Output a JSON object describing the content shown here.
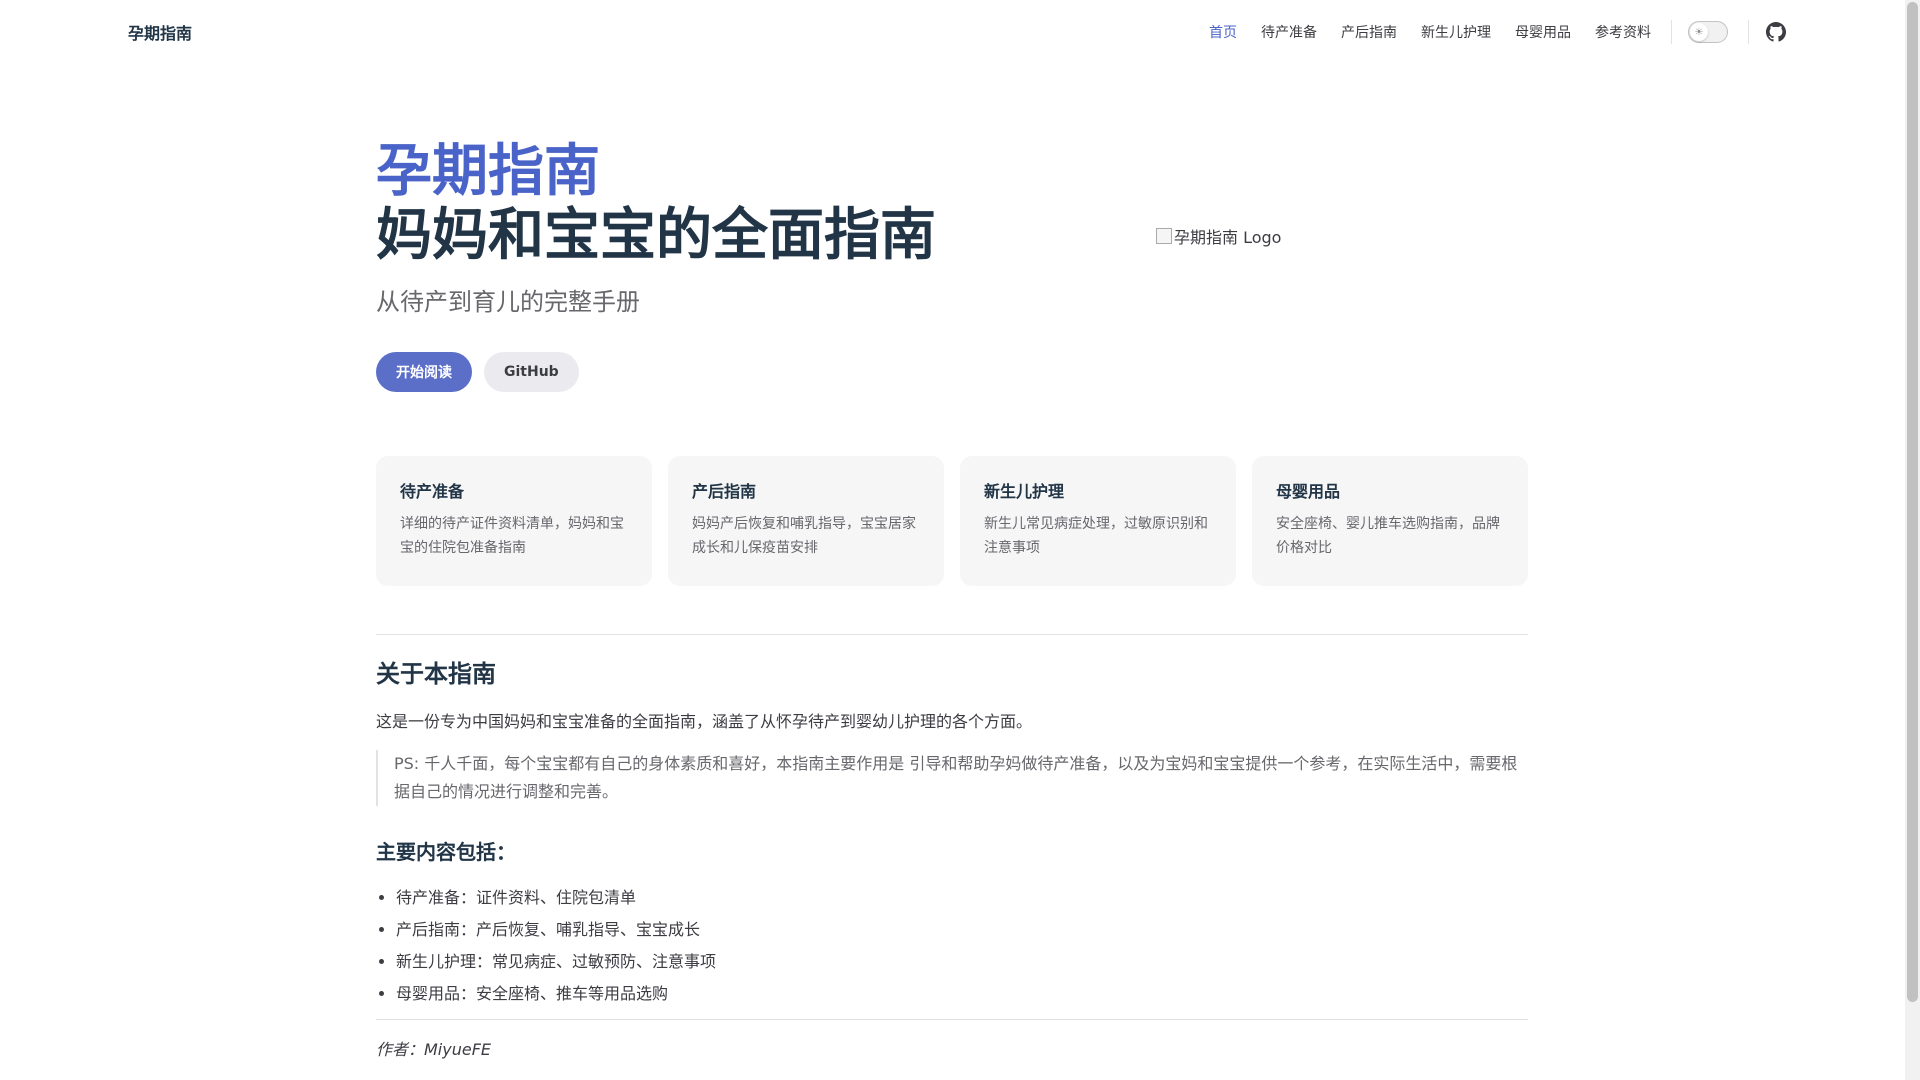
{
  "nav": {
    "brand": "孕期指南",
    "links": [
      {
        "label": "首页"
      },
      {
        "label": "待产准备"
      },
      {
        "label": "产后指南"
      },
      {
        "label": "新生儿护理"
      },
      {
        "label": "母婴用品"
      },
      {
        "label": "参考资料"
      }
    ]
  },
  "hero": {
    "name": "孕期指南",
    "text": "妈妈和宝宝的全面指南",
    "tagline": "从待产到育儿的完整手册",
    "actions": [
      {
        "label": "开始阅读"
      },
      {
        "label": "GitHub"
      }
    ],
    "image_alt": "孕期指南 Logo"
  },
  "features": [
    {
      "title": "待产准备",
      "details": "详细的待产证件资料清单，妈妈和宝宝的住院包准备指南"
    },
    {
      "title": "产后指南",
      "details": "妈妈产后恢复和哺乳指导，宝宝居家成长和儿保疫苗安排"
    },
    {
      "title": "新生儿护理",
      "details": "新生儿常见病症处理，过敏原识别和注意事项"
    },
    {
      "title": "母婴用品",
      "details": "安全座椅、婴儿推车选购指南，品牌价格对比"
    }
  ],
  "content": {
    "about_title": "关于本指南",
    "about_text": "这是一份专为中国妈妈和宝宝准备的全面指南，涵盖了从怀孕待产到婴幼儿护理的各个方面。",
    "note": "PS: 千人千面，每个宝宝都有自己的身体素质和喜好，本指南主要作用是 引导和帮助孕妈做待产准备，以及为宝妈和宝宝提供一个参考，在实际生活中，需要根据自己的情况进行调整和完善。",
    "main_title": "主要内容包括：",
    "items": [
      "待产准备：证件资料、住院包清单",
      "产后指南：产后恢复、哺乳指导、宝宝成长",
      "新生儿护理：常见病症、过敏预防、注意事项",
      "母婴用品：安全座椅、推车等用品选购"
    ],
    "author": "作者：MiyueFE"
  },
  "colors": {
    "brand": "#4a63c8",
    "button_brand": "#5b6fc9",
    "card_bg": "#f6f6f7"
  }
}
